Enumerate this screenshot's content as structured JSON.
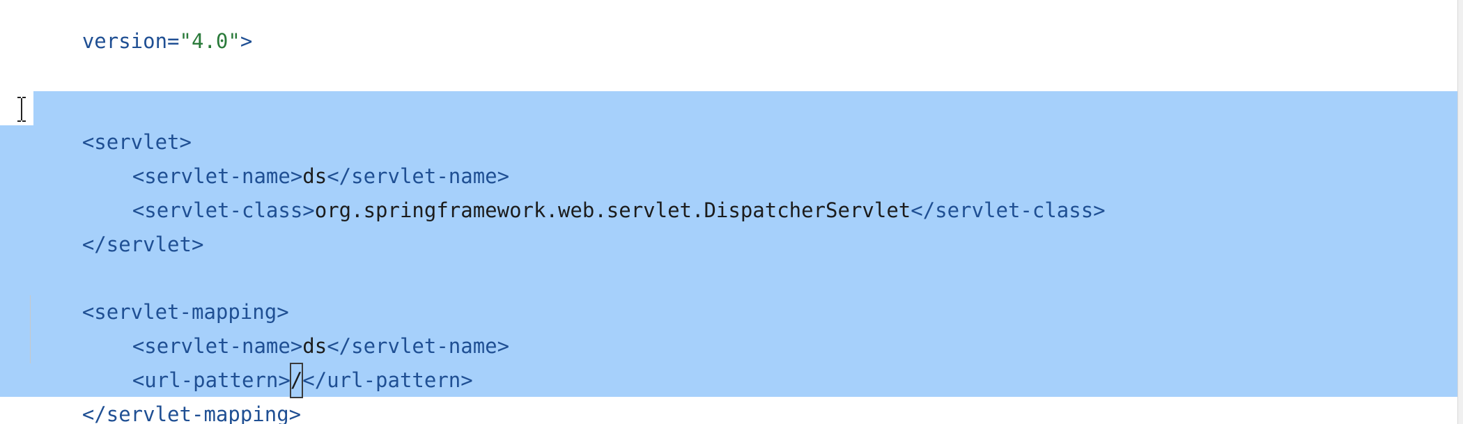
{
  "editor": {
    "language": "xml",
    "lines": {
      "l1_attr": "version=",
      "l1_value": "\"4.0\"",
      "l1_end": ">",
      "servlet_open": "<servlet>",
      "servlet_name_open": "<servlet-name>",
      "servlet_name_value": "ds",
      "servlet_name_close": "</servlet-name>",
      "servlet_class_open": "<servlet-class>",
      "servlet_class_value": "org.springframework.web.servlet.DispatcherServlet",
      "servlet_class_close": "</servlet-class>",
      "servlet_close": "</servlet>",
      "mapping_open": "<servlet-mapping>",
      "mapping_name_open": "<servlet-name>",
      "mapping_name_value": "ds",
      "mapping_name_close": "</servlet-name>",
      "url_open": "<url-pattern>",
      "url_value": "/",
      "url_close": "</url-pattern>",
      "mapping_close": "</servlet-mapping>"
    },
    "colors": {
      "selection": "#a6d0fb",
      "tag": "#1f4f93",
      "string": "#2a7a3a",
      "text": "#1c1c1c"
    },
    "icons": {
      "mouse_cursor": "ibeam-cursor-icon"
    }
  }
}
